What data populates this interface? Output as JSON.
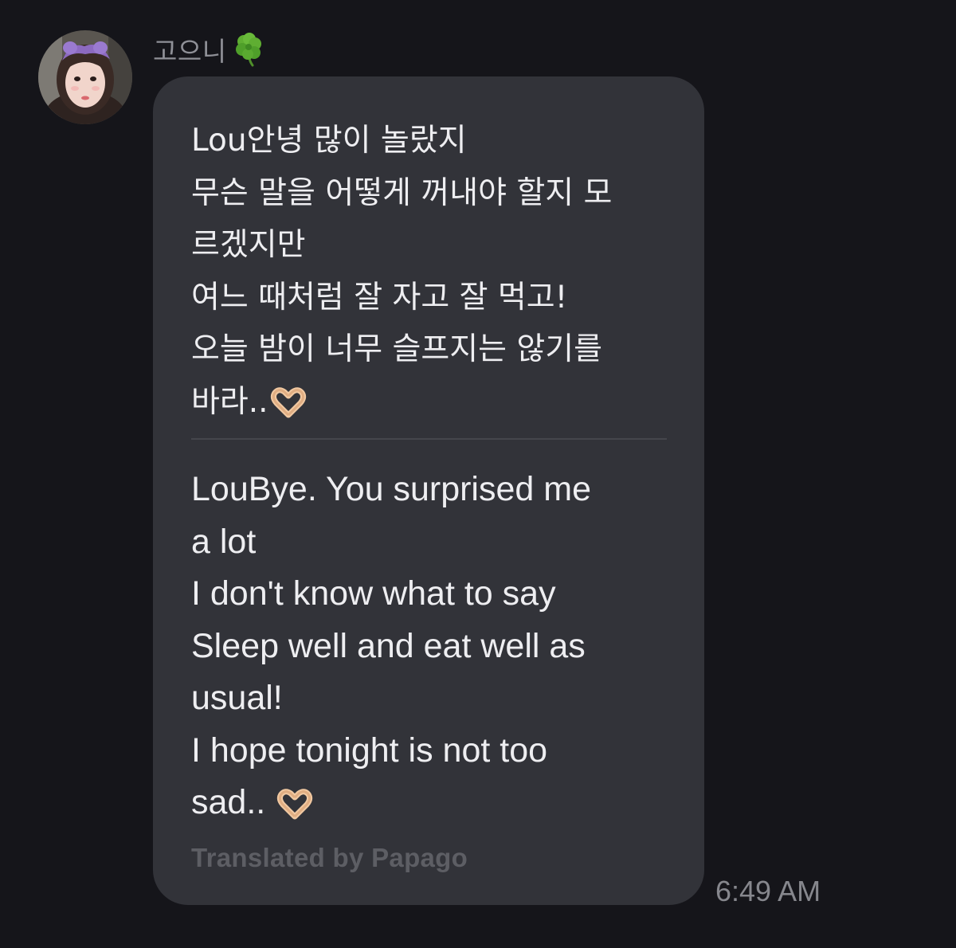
{
  "sender": {
    "name": "고으니",
    "name_icon": "four-leaf-clover-icon",
    "avatar_icon": "profile-photo-avatar"
  },
  "message": {
    "original_lines": [
      "Lou안녕 많이 놀랐지",
      "무슨 말을 어떻게 꺼내야 할지 모",
      "르겠지만",
      "여느 때처럼 잘 자고 잘 먹고!",
      "오늘 밤이 너무 슬프지는 않기를",
      "바라.."
    ],
    "translation_lines": [
      "LouBye. You surprised me",
      "a lot",
      "I don't know what to say",
      "Sleep well and eat well as",
      "usual!",
      "I hope tonight is not too",
      "sad.."
    ],
    "emoji_icon": "heart-hands-icon",
    "translation_credit": "Translated by Papago",
    "timestamp": "6:49 AM"
  },
  "colors": {
    "background": "#15151a",
    "bubble": "#323339",
    "text": "#eeeef1",
    "muted_text": "#8f9097",
    "credit_text": "#5d5e64"
  }
}
